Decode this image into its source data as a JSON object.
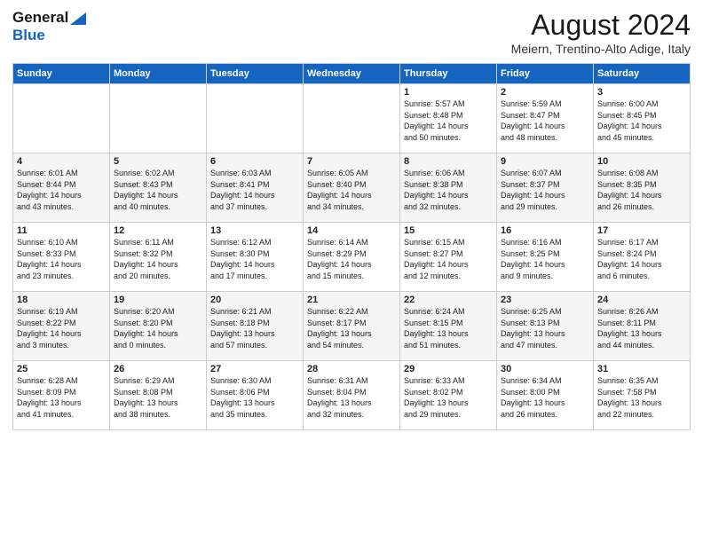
{
  "header": {
    "logo_line1": "General",
    "logo_line2": "Blue",
    "month_year": "August 2024",
    "location": "Meiern, Trentino-Alto Adige, Italy"
  },
  "days_of_week": [
    "Sunday",
    "Monday",
    "Tuesday",
    "Wednesday",
    "Thursday",
    "Friday",
    "Saturday"
  ],
  "weeks": [
    [
      {
        "day": "",
        "content": ""
      },
      {
        "day": "",
        "content": ""
      },
      {
        "day": "",
        "content": ""
      },
      {
        "day": "",
        "content": ""
      },
      {
        "day": "1",
        "content": "Sunrise: 5:57 AM\nSunset: 8:48 PM\nDaylight: 14 hours\nand 50 minutes."
      },
      {
        "day": "2",
        "content": "Sunrise: 5:59 AM\nSunset: 8:47 PM\nDaylight: 14 hours\nand 48 minutes."
      },
      {
        "day": "3",
        "content": "Sunrise: 6:00 AM\nSunset: 8:45 PM\nDaylight: 14 hours\nand 45 minutes."
      }
    ],
    [
      {
        "day": "4",
        "content": "Sunrise: 6:01 AM\nSunset: 8:44 PM\nDaylight: 14 hours\nand 43 minutes."
      },
      {
        "day": "5",
        "content": "Sunrise: 6:02 AM\nSunset: 8:43 PM\nDaylight: 14 hours\nand 40 minutes."
      },
      {
        "day": "6",
        "content": "Sunrise: 6:03 AM\nSunset: 8:41 PM\nDaylight: 14 hours\nand 37 minutes."
      },
      {
        "day": "7",
        "content": "Sunrise: 6:05 AM\nSunset: 8:40 PM\nDaylight: 14 hours\nand 34 minutes."
      },
      {
        "day": "8",
        "content": "Sunrise: 6:06 AM\nSunset: 8:38 PM\nDaylight: 14 hours\nand 32 minutes."
      },
      {
        "day": "9",
        "content": "Sunrise: 6:07 AM\nSunset: 8:37 PM\nDaylight: 14 hours\nand 29 minutes."
      },
      {
        "day": "10",
        "content": "Sunrise: 6:08 AM\nSunset: 8:35 PM\nDaylight: 14 hours\nand 26 minutes."
      }
    ],
    [
      {
        "day": "11",
        "content": "Sunrise: 6:10 AM\nSunset: 8:33 PM\nDaylight: 14 hours\nand 23 minutes."
      },
      {
        "day": "12",
        "content": "Sunrise: 6:11 AM\nSunset: 8:32 PM\nDaylight: 14 hours\nand 20 minutes."
      },
      {
        "day": "13",
        "content": "Sunrise: 6:12 AM\nSunset: 8:30 PM\nDaylight: 14 hours\nand 17 minutes."
      },
      {
        "day": "14",
        "content": "Sunrise: 6:14 AM\nSunset: 8:29 PM\nDaylight: 14 hours\nand 15 minutes."
      },
      {
        "day": "15",
        "content": "Sunrise: 6:15 AM\nSunset: 8:27 PM\nDaylight: 14 hours\nand 12 minutes."
      },
      {
        "day": "16",
        "content": "Sunrise: 6:16 AM\nSunset: 8:25 PM\nDaylight: 14 hours\nand 9 minutes."
      },
      {
        "day": "17",
        "content": "Sunrise: 6:17 AM\nSunset: 8:24 PM\nDaylight: 14 hours\nand 6 minutes."
      }
    ],
    [
      {
        "day": "18",
        "content": "Sunrise: 6:19 AM\nSunset: 8:22 PM\nDaylight: 14 hours\nand 3 minutes."
      },
      {
        "day": "19",
        "content": "Sunrise: 6:20 AM\nSunset: 8:20 PM\nDaylight: 14 hours\nand 0 minutes."
      },
      {
        "day": "20",
        "content": "Sunrise: 6:21 AM\nSunset: 8:18 PM\nDaylight: 13 hours\nand 57 minutes."
      },
      {
        "day": "21",
        "content": "Sunrise: 6:22 AM\nSunset: 8:17 PM\nDaylight: 13 hours\nand 54 minutes."
      },
      {
        "day": "22",
        "content": "Sunrise: 6:24 AM\nSunset: 8:15 PM\nDaylight: 13 hours\nand 51 minutes."
      },
      {
        "day": "23",
        "content": "Sunrise: 6:25 AM\nSunset: 8:13 PM\nDaylight: 13 hours\nand 47 minutes."
      },
      {
        "day": "24",
        "content": "Sunrise: 6:26 AM\nSunset: 8:11 PM\nDaylight: 13 hours\nand 44 minutes."
      }
    ],
    [
      {
        "day": "25",
        "content": "Sunrise: 6:28 AM\nSunset: 8:09 PM\nDaylight: 13 hours\nand 41 minutes."
      },
      {
        "day": "26",
        "content": "Sunrise: 6:29 AM\nSunset: 8:08 PM\nDaylight: 13 hours\nand 38 minutes."
      },
      {
        "day": "27",
        "content": "Sunrise: 6:30 AM\nSunset: 8:06 PM\nDaylight: 13 hours\nand 35 minutes."
      },
      {
        "day": "28",
        "content": "Sunrise: 6:31 AM\nSunset: 8:04 PM\nDaylight: 13 hours\nand 32 minutes."
      },
      {
        "day": "29",
        "content": "Sunrise: 6:33 AM\nSunset: 8:02 PM\nDaylight: 13 hours\nand 29 minutes."
      },
      {
        "day": "30",
        "content": "Sunrise: 6:34 AM\nSunset: 8:00 PM\nDaylight: 13 hours\nand 26 minutes."
      },
      {
        "day": "31",
        "content": "Sunrise: 6:35 AM\nSunset: 7:58 PM\nDaylight: 13 hours\nand 22 minutes."
      }
    ]
  ]
}
